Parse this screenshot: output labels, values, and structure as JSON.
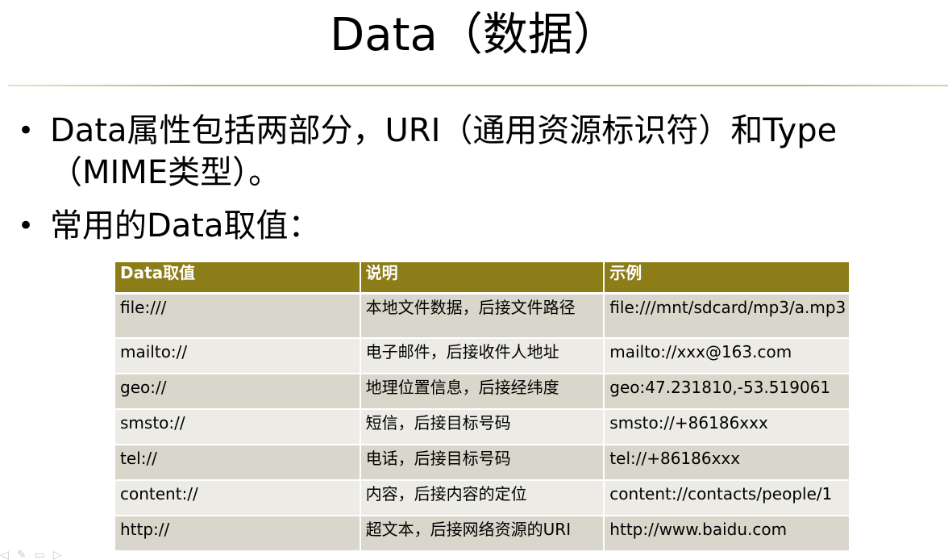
{
  "title": "Data（数据）",
  "bullets": [
    {
      "text": "Data属性包括两部分，URI（通用资源标识符）和Type（MIME类型）。"
    },
    {
      "text": "常用的Data取值："
    }
  ],
  "table": {
    "headers": [
      "Data取值",
      "说明",
      "示例"
    ],
    "rows": [
      {
        "scheme": "file:///",
        "desc": "本地文件数据，后接文件路径",
        "example": "file:///mnt/sdcard/mp3/a.mp3"
      },
      {
        "scheme": "mailto://",
        "desc": "电子邮件，后接收件人地址",
        "example": "mailto://xxx@163.com"
      },
      {
        "scheme": "geo://",
        "desc": "地理位置信息，后接经纬度",
        "example": "geo:47.231810,-53.519061"
      },
      {
        "scheme": "smsto://",
        "desc": "短信，后接目标号码",
        "example": "smsto://+86186xxx"
      },
      {
        "scheme": "tel://",
        "desc": "电话，后接目标号码",
        "example": "tel://+86186xxx"
      },
      {
        "scheme": "content://",
        "desc": "内容，后接内容的定位",
        "example": "content://contacts/people/1"
      },
      {
        "scheme": "http://",
        "desc": "超文本，后接网络资源的URI",
        "example": "http://www.baidu.com"
      }
    ]
  },
  "colors": {
    "header_bg": "#8c7d18",
    "row_odd": "#d9d7cb",
    "row_even": "#ecebe6",
    "title_rule": "#b8b07a"
  },
  "icons": [
    "prev-slide-icon",
    "pen-icon",
    "menu-icon",
    "next-slide-icon"
  ]
}
